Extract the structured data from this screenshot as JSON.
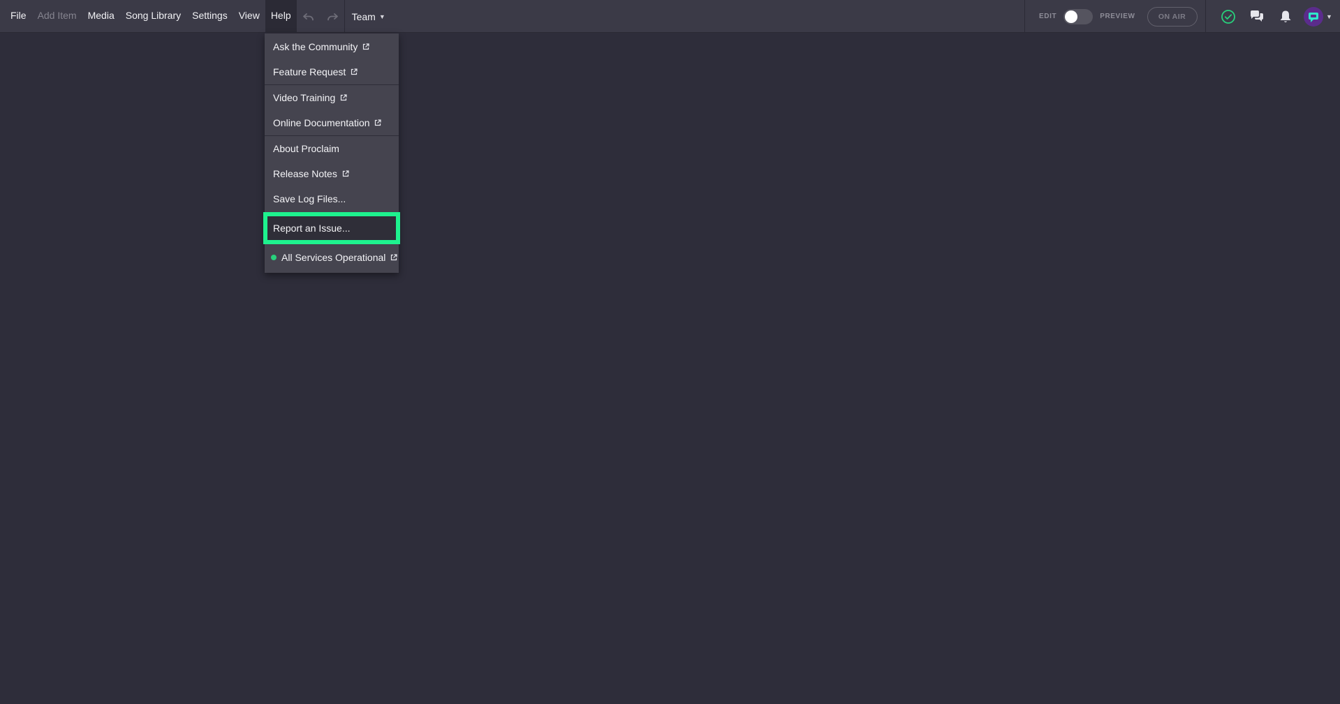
{
  "menubar": {
    "items": [
      {
        "label": "File",
        "enabled": true
      },
      {
        "label": "Add Item",
        "enabled": false
      },
      {
        "label": "Media",
        "enabled": true
      },
      {
        "label": "Song Library",
        "enabled": true
      },
      {
        "label": "Settings",
        "enabled": true
      },
      {
        "label": "View",
        "enabled": true
      },
      {
        "label": "Help",
        "enabled": true,
        "active": true
      }
    ],
    "team_label": "Team"
  },
  "mode": {
    "edit_label": "EDIT",
    "preview_label": "PREVIEW",
    "on_air_label": "ON AIR",
    "preview_enabled": false
  },
  "help_menu": {
    "items": [
      {
        "label": "Ask the Community",
        "external": true
      },
      {
        "label": "Feature Request",
        "external": true
      },
      {
        "label": "Video Training",
        "external": true
      },
      {
        "label": "Online Documentation",
        "external": true
      },
      {
        "label": "About Proclaim",
        "external": false
      },
      {
        "label": "Release Notes",
        "external": true
      },
      {
        "label": "Save Log Files...",
        "external": false
      },
      {
        "label": "Report an Issue...",
        "external": false,
        "highlighted": true
      },
      {
        "label": "All Services Operational",
        "external": true,
        "status": "operational"
      }
    ]
  },
  "colors": {
    "background": "#2e2d3a",
    "topbar": "#3b3a47",
    "menu": "#45444f",
    "highlight_border": "#1ef28e",
    "status_ok": "#28d17c",
    "avatar": "#5b2c8c"
  },
  "icons": {
    "undo": "undo-icon",
    "redo": "redo-icon",
    "status": "check-circle-icon",
    "chat": "chat-icon",
    "notifications": "bell-icon",
    "external": "external-link-icon"
  }
}
